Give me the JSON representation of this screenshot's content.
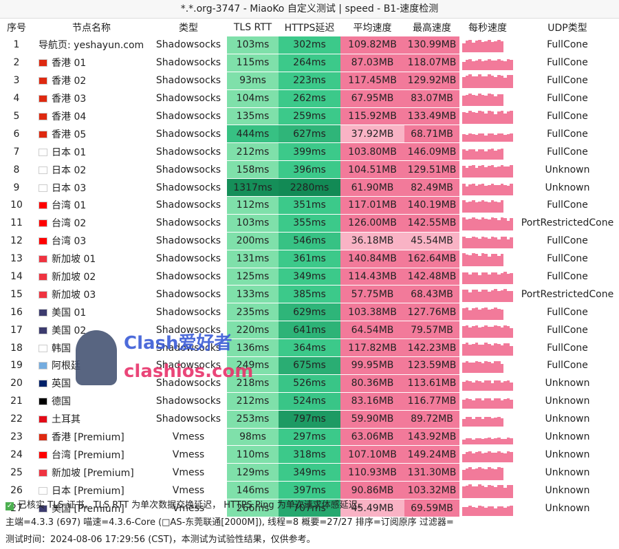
{
  "title": "*.*.org-3747 - MiaoKo 自定义测试 | speed - B1-速度检测",
  "headers": [
    "序号",
    "节点名称",
    "类型",
    "TLS RTT",
    "HTTPS延迟",
    "平均速度",
    "最高速度",
    "每秒速度",
    "UDP类型"
  ],
  "rows": [
    [
      "1",
      "导航页: yeshayun.com",
      "Shadowsocks",
      "103ms",
      "302ms",
      "109.82MB",
      "130.99MB",
      "FullCone",
      ""
    ],
    [
      "2",
      "香港 01",
      "Shadowsocks",
      "115ms",
      "264ms",
      "87.03MB",
      "118.07MB",
      "FullCone",
      "hk"
    ],
    [
      "3",
      "香港 02",
      "Shadowsocks",
      "93ms",
      "223ms",
      "117.45MB",
      "129.92MB",
      "FullCone",
      "hk"
    ],
    [
      "4",
      "香港 03",
      "Shadowsocks",
      "104ms",
      "262ms",
      "67.95MB",
      "83.07MB",
      "FullCone",
      "hk"
    ],
    [
      "5",
      "香港 04",
      "Shadowsocks",
      "135ms",
      "259ms",
      "115.92MB",
      "133.49MB",
      "FullCone",
      "hk"
    ],
    [
      "6",
      "香港 05",
      "Shadowsocks",
      "444ms",
      "627ms",
      "37.92MB",
      "68.71MB",
      "FullCone",
      "hk"
    ],
    [
      "7",
      "日本 01",
      "Shadowsocks",
      "212ms",
      "399ms",
      "103.80MB",
      "146.09MB",
      "FullCone",
      "jp"
    ],
    [
      "8",
      "日本 02",
      "Shadowsocks",
      "158ms",
      "396ms",
      "104.51MB",
      "129.51MB",
      "Unknown",
      "jp"
    ],
    [
      "9",
      "日本 03",
      "Shadowsocks",
      "1317ms",
      "2280ms",
      "61.90MB",
      "82.49MB",
      "Unknown",
      "jp"
    ],
    [
      "10",
      "台湾 01",
      "Shadowsocks",
      "112ms",
      "351ms",
      "117.01MB",
      "140.19MB",
      "FullCone",
      "tw"
    ],
    [
      "11",
      "台湾 02",
      "Shadowsocks",
      "103ms",
      "355ms",
      "126.00MB",
      "142.55MB",
      "PortRestrictedCone",
      "tw"
    ],
    [
      "12",
      "台湾 03",
      "Shadowsocks",
      "200ms",
      "546ms",
      "36.18MB",
      "45.54MB",
      "FullCone",
      "tw"
    ],
    [
      "13",
      "新加坡 01",
      "Shadowsocks",
      "131ms",
      "361ms",
      "140.84MB",
      "162.64MB",
      "FullCone",
      "sg"
    ],
    [
      "14",
      "新加坡 02",
      "Shadowsocks",
      "125ms",
      "349ms",
      "114.43MB",
      "142.48MB",
      "FullCone",
      "sg"
    ],
    [
      "15",
      "新加坡 03",
      "Shadowsocks",
      "133ms",
      "385ms",
      "57.75MB",
      "68.43MB",
      "PortRestrictedCone",
      "sg"
    ],
    [
      "16",
      "美国 01",
      "Shadowsocks",
      "235ms",
      "629ms",
      "103.38MB",
      "127.76MB",
      "FullCone",
      "us"
    ],
    [
      "17",
      "美国 02",
      "Shadowsocks",
      "220ms",
      "641ms",
      "64.54MB",
      "79.57MB",
      "FullCone",
      "us"
    ],
    [
      "18",
      "韩国",
      "Shadowsocks",
      "136ms",
      "364ms",
      "117.82MB",
      "142.23MB",
      "FullCone",
      "kr"
    ],
    [
      "19",
      "阿根廷",
      "Shadowsocks",
      "249ms",
      "675ms",
      "99.95MB",
      "123.59MB",
      "FullCone",
      "ar"
    ],
    [
      "20",
      "英国",
      "Shadowsocks",
      "218ms",
      "526ms",
      "80.36MB",
      "113.61MB",
      "Unknown",
      "gb"
    ],
    [
      "21",
      "德国",
      "Shadowsocks",
      "212ms",
      "524ms",
      "83.16MB",
      "116.77MB",
      "Unknown",
      "de"
    ],
    [
      "22",
      "土耳其",
      "Shadowsocks",
      "253ms",
      "797ms",
      "59.90MB",
      "89.72MB",
      "Unknown",
      "tr"
    ],
    [
      "23",
      "香港 [Premium]",
      "Vmess",
      "98ms",
      "297ms",
      "63.06MB",
      "143.92MB",
      "Unknown",
      "hk"
    ],
    [
      "24",
      "台湾 [Premium]",
      "Vmess",
      "110ms",
      "318ms",
      "107.10MB",
      "149.24MB",
      "Unknown",
      "tw"
    ],
    [
      "25",
      "新加坡 [Premium]",
      "Vmess",
      "129ms",
      "349ms",
      "110.93MB",
      "131.30MB",
      "Unknown",
      "sg"
    ],
    [
      "26",
      "日本 [Premium]",
      "Vmess",
      "146ms",
      "397ms",
      "90.86MB",
      "103.32MB",
      "Unknown",
      "jp"
    ],
    [
      "27",
      "美国 [Premium]",
      "Vmess",
      "266ms",
      "707ms",
      "45.49MB",
      "69.59MB",
      "Unknown",
      "us"
    ]
  ],
  "footer": {
    "line1": "已核实 TLS 证书。TLS RTT 为单次数据交换延迟， HTTPS Ping 为单次请求体感延迟。",
    "line2": "主端=4.3.3 (697) 喵速=4.3.6-Core (□AS-东莞联通[2000M]), 线程=8 概要=27/27 排序=订阅原序 过滤器=",
    "line3": "测试时间：2024-08-06 17:29:56 (CST)，本测试为试验性结果，仅供参考。"
  },
  "watermark": {
    "line1": "Clash爱好者",
    "line2": "clashios.com"
  },
  "colors": {
    "green_light": "#7fe0aa",
    "green_mid": "#3cc98a",
    "green_dark": "#128a55",
    "pink": "#f27a9a",
    "pink_light": "#f9b3c5"
  }
}
